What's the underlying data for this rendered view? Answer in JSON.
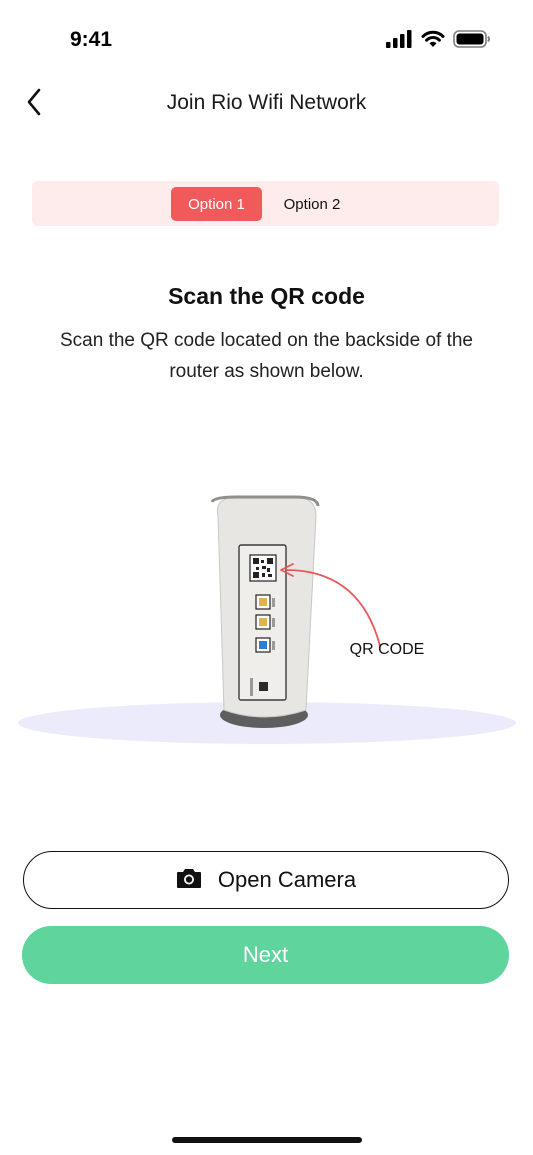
{
  "status_bar": {
    "time": "9:41",
    "icons": [
      "cellular-signal-icon",
      "wifi-icon",
      "battery-icon"
    ]
  },
  "nav": {
    "back_icon": "chevron-left-icon",
    "title": "Join Rio Wifi Network"
  },
  "options": {
    "option1_label": "Option 1",
    "option2_label": "Option 2",
    "selected": "Option 1"
  },
  "content": {
    "heading": "Scan the QR code",
    "description": "Scan the QR code located on the backside of the router as shown below."
  },
  "illustration": {
    "qr_label": "QR CODE"
  },
  "buttons": {
    "camera_icon": "camera-icon",
    "open_camera_label": "Open Camera",
    "next_label": "Next"
  },
  "colors": {
    "accent_red": "#f05a5b",
    "segment_bg": "#fdeceb",
    "next_green": "#5fd49c",
    "floor_lavender": "#ecebfb"
  }
}
